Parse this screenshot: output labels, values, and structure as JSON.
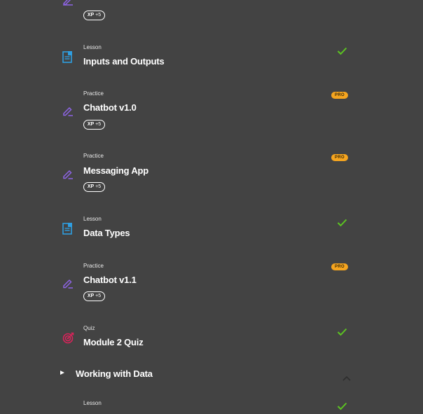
{
  "items": [
    {
      "kind": "",
      "title": "",
      "xp": "XP",
      "xp_bonus": "+5",
      "icon": "practice-pencil-icon",
      "status": "none"
    },
    {
      "kind": "Lesson",
      "title": "Inputs and Outputs",
      "icon": "lesson-document-icon",
      "status": "completed"
    },
    {
      "kind": "Practice",
      "title": "Chatbot v1.0",
      "xp": "XP",
      "xp_bonus": "+5",
      "icon": "practice-pencil-icon",
      "pro": "PRO"
    },
    {
      "kind": "Practice",
      "title": "Messaging App",
      "xp": "XP",
      "xp_bonus": "+5",
      "icon": "practice-pencil-icon",
      "pro": "PRO"
    },
    {
      "kind": "Lesson",
      "title": "Data Types",
      "icon": "lesson-document-icon",
      "status": "completed"
    },
    {
      "kind": "Practice",
      "title": "Chatbot v1.1",
      "xp": "XP",
      "xp_bonus": "+5",
      "icon": "practice-pencil-icon",
      "pro": "PRO"
    },
    {
      "kind": "Quiz",
      "title": "Module 2 Quiz",
      "icon": "quiz-target-icon",
      "status": "completed"
    },
    {
      "kind": "Lesson",
      "title": "",
      "icon": "",
      "status": "completed"
    }
  ],
  "section": {
    "label": "Working with Data",
    "state": "collapsed"
  },
  "colors": {
    "background": "#434343",
    "lesson_icon": "#2f9ee0",
    "practice_icon": "#8e64e6",
    "quiz_icon": "#d8245a",
    "check": "#5cc521",
    "pro_badge": "#f6a51f",
    "text": "#ffffff"
  }
}
